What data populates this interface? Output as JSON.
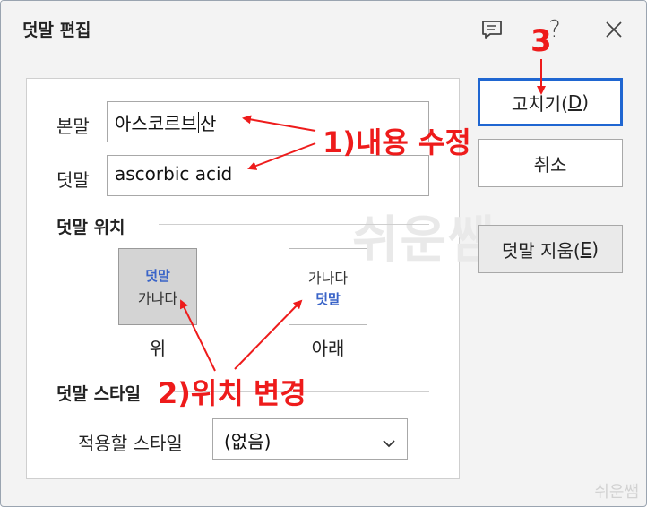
{
  "window": {
    "title": "덧말 편집"
  },
  "fields": {
    "main_label": "본말",
    "main_value_before": "아스코르브",
    "main_value_after": "산",
    "ruby_label": "덧말",
    "ruby_value": "ascorbic acid"
  },
  "position": {
    "section_title": "덧말 위치",
    "above": {
      "ruby": "덧말",
      "base": "가나다",
      "caption": "위",
      "selected": true
    },
    "below": {
      "base": "가나다",
      "ruby": "덧말",
      "caption": "아래",
      "selected": false
    }
  },
  "style": {
    "section_title": "덧말 스타일",
    "apply_label": "적용할 스타일",
    "selected": "(없음)"
  },
  "buttons": {
    "ok": {
      "text": "고치기(",
      "key": "D",
      "close": ")"
    },
    "cancel": "취소",
    "remove": {
      "text": "덧말 지움(",
      "key": "E",
      "close": ")"
    }
  },
  "watermark": {
    "center": "쉬운쌤",
    "corner": "쉬운쌤"
  },
  "annotations": {
    "step1": "1)내용 수정",
    "step2": "2)위치 변경",
    "step3": "3"
  },
  "colors": {
    "annotation": "#ee1b1b",
    "accent": "#1f66d1",
    "ruby": "#3a64c8"
  },
  "icons": {
    "comment": "comment-icon",
    "help": "help-icon",
    "close": "close-icon",
    "dropdown": "chevron-down-icon"
  }
}
